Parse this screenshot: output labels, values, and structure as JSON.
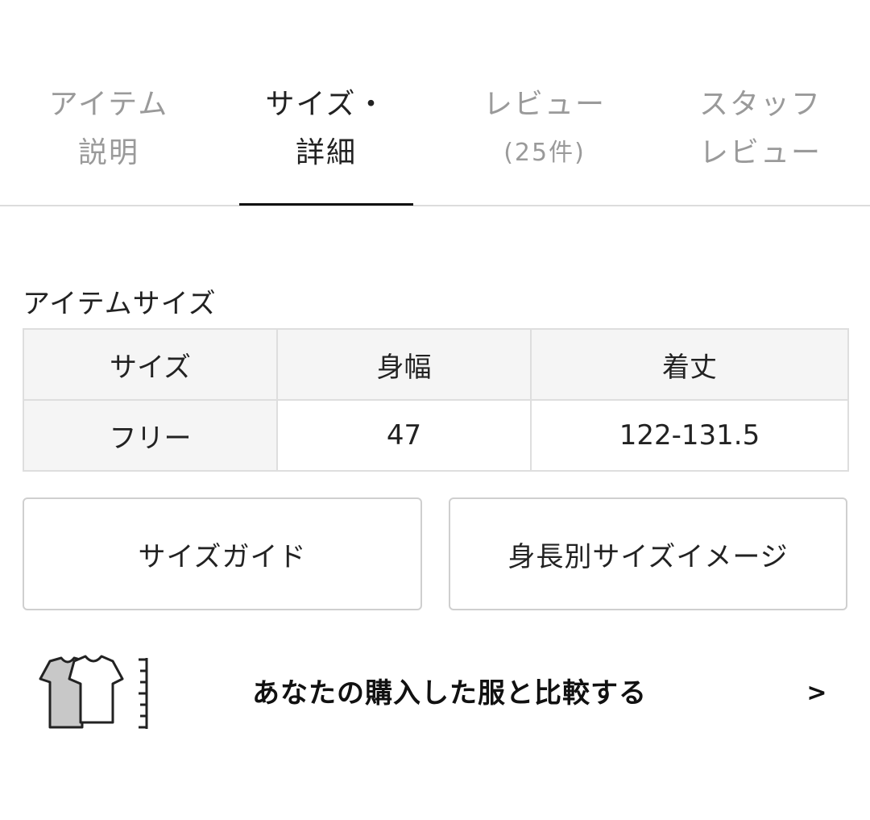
{
  "tabs": [
    {
      "line1": "アイテム",
      "line2": "説明"
    },
    {
      "line1": "サイズ・",
      "line2": "詳細"
    },
    {
      "line1": "レビュー",
      "line2": "(25件)"
    },
    {
      "line1": "スタッフ",
      "line2": "レビュー"
    }
  ],
  "active_tab": 1,
  "section": {
    "title": "アイテムサイズ"
  },
  "size_table": {
    "headers": [
      "サイズ",
      "身幅",
      "着丈"
    ],
    "rows": [
      [
        "フリー",
        "47",
        "122-131.5"
      ]
    ]
  },
  "buttons": {
    "size_guide": "サイズガイド",
    "height_image": "身長別サイズイメージ"
  },
  "compare": {
    "text": "あなたの購入した服と比較する",
    "arrow": ">",
    "icon": "tshirt-ruler-icon"
  },
  "colors": {
    "active_text": "#222222",
    "inactive_text": "#9a9a9a",
    "table_header_bg": "#f5f5f5",
    "border": "#dedede",
    "indicator": "#111111"
  }
}
